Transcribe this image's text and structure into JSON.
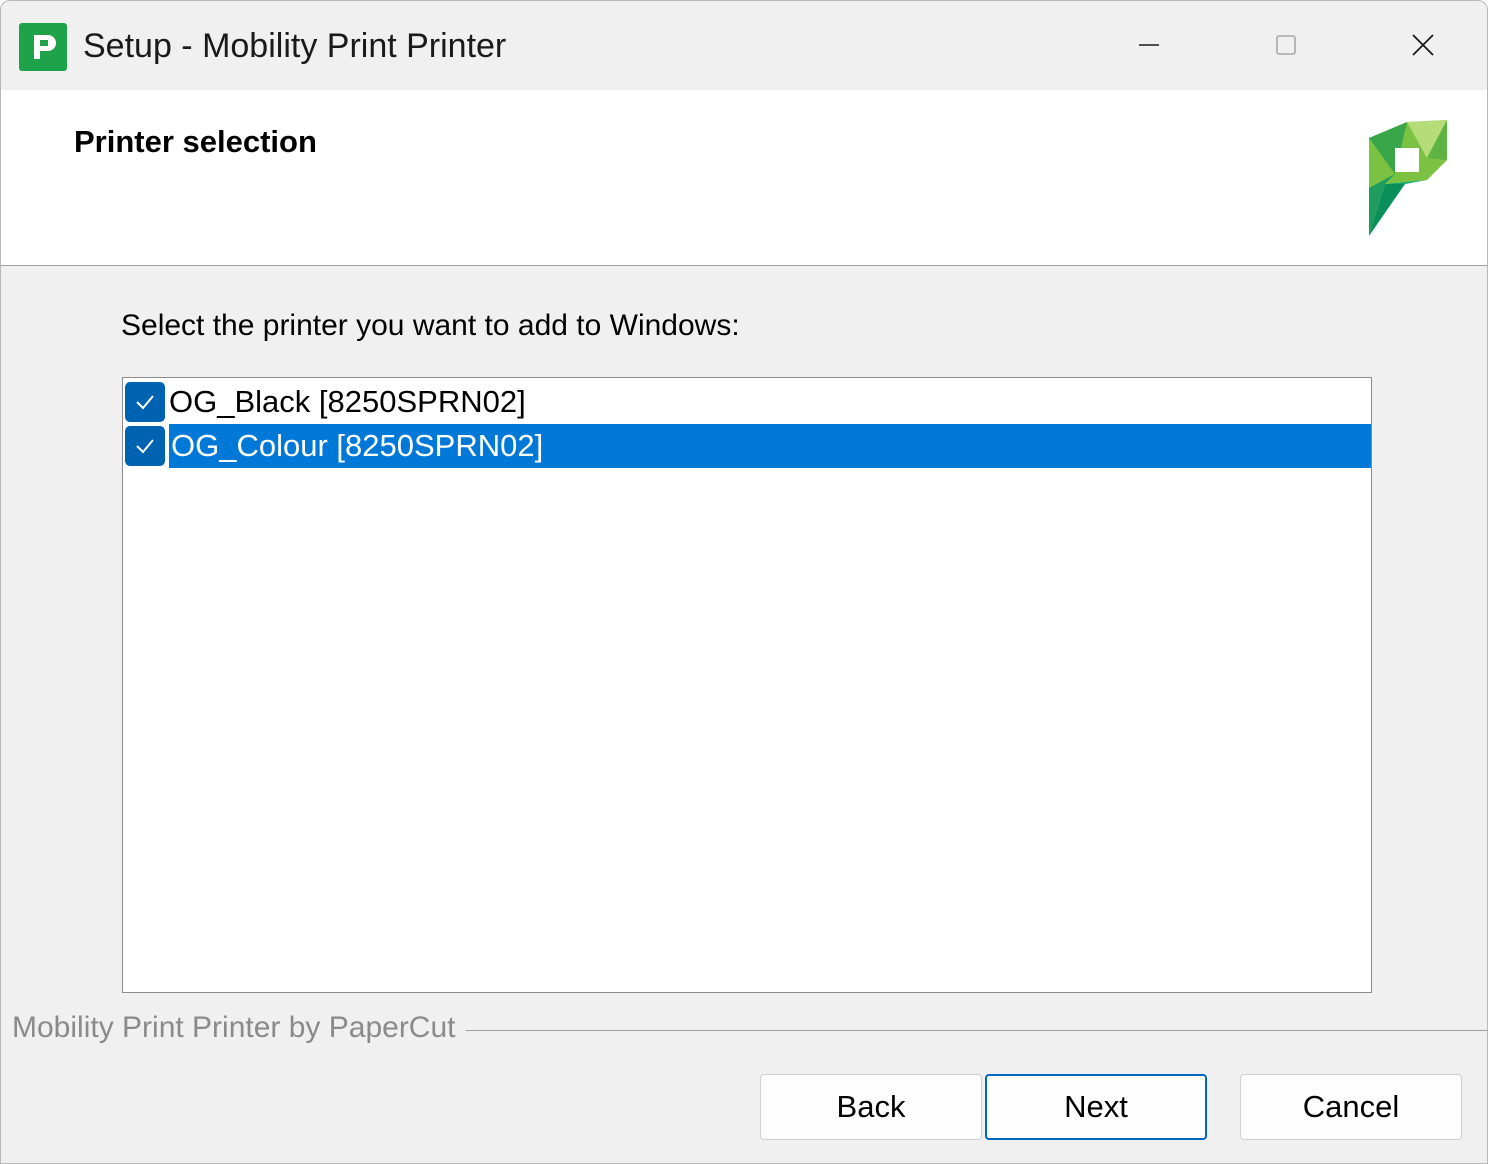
{
  "window": {
    "title": "Setup - Mobility Print Printer"
  },
  "header": {
    "title": "Printer selection"
  },
  "main": {
    "prompt": "Select the printer you want to add to Windows:",
    "printers": [
      {
        "label": "OG_Black [8250SPRN02]",
        "checked": true,
        "selected": false
      },
      {
        "label": "OG_Colour [8250SPRN02]",
        "checked": true,
        "selected": true
      }
    ]
  },
  "footer": {
    "brand": "Mobility Print Printer by PaperCut",
    "back_label": "Back",
    "next_label": "Next",
    "cancel_label": "Cancel"
  },
  "icons": {
    "app": "papercut-app-icon",
    "logo": "papercut-logo",
    "minimize": "minimize-icon",
    "maximize": "maximize-icon",
    "close": "close-icon",
    "check": "checkmark-icon"
  },
  "colors": {
    "selection": "#0078d7",
    "checkbox": "#0063b1",
    "brand_green": "#1ea34a",
    "default_button_border": "#0067c0"
  }
}
